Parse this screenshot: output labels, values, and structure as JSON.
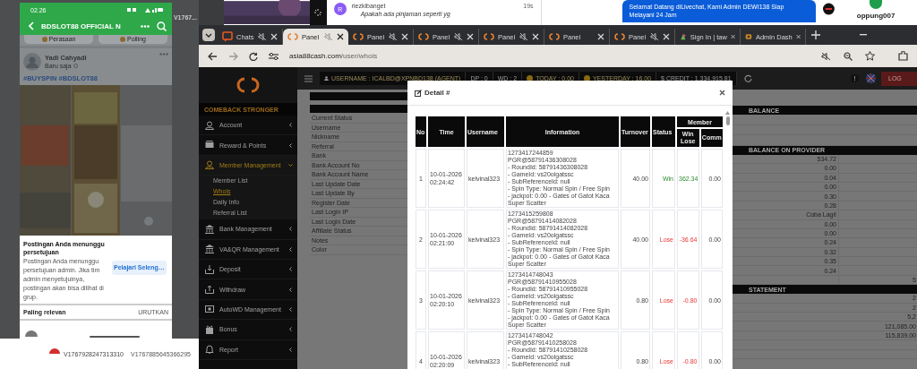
{
  "left_app": {
    "top_label": "V1767...",
    "rows": [
      {
        "label": "V1767928247313310"
      }
    ],
    "preview_label": "V1767885645366295"
  },
  "chat_app": {
    "contact": {
      "initial": "R",
      "name": "riezkibanget",
      "time": "19s",
      "message": "Apakah ada pinjaman seperti yg"
    },
    "bubble": "Selamat Datang diLivechat, Kami Admin DEWI138 Siap Melayani 24 Jam",
    "username": "oppung007"
  },
  "phone": {
    "time": "02.26",
    "title": "BDSLOT88 OFFICIAL N",
    "chips": [
      "Perasaan",
      "Polling"
    ],
    "post": {
      "author": "Yadi Cahyadi",
      "meta": "Baru saja",
      "hashtags": "#BUYSPIN #BDSLOT88"
    },
    "sheet": {
      "title": "Postingan Anda menunggu persetujuan",
      "body": "Postingan Anda menunggu persetujuan admin. Jika tim admin menyetujuinya, postingan akan bisa dilihat di grup.",
      "button": "Pelajari Seleng…"
    },
    "sort": {
      "label": "Paling relevan",
      "action": "URUTKAN"
    }
  },
  "browser": {
    "tabs": [
      {
        "title": "Chats",
        "kind": "chat",
        "selected": false,
        "muted": true
      },
      {
        "title": "Panel",
        "kind": "panel",
        "selected": true,
        "muted": true
      },
      {
        "title": "Panel",
        "kind": "panel",
        "selected": false,
        "muted": true
      },
      {
        "title": "Panel",
        "kind": "panel",
        "selected": false,
        "muted": true
      },
      {
        "title": "Panel",
        "kind": "panel",
        "selected": false,
        "muted": true
      },
      {
        "title": "Panel",
        "kind": "panel",
        "selected": false,
        "muted": false
      },
      {
        "title": "Panel",
        "kind": "panel",
        "selected": false,
        "muted": true
      },
      {
        "title": "Sign In | taw",
        "kind": "signin",
        "selected": false,
        "muted": false
      },
      {
        "title": "Admin Dash",
        "kind": "admin",
        "selected": false,
        "muted": false
      }
    ],
    "url": {
      "domain": "asia88cash.com",
      "path": "/user/whois"
    }
  },
  "header": {
    "stats": [
      {
        "kind": "user",
        "text": "USERNAME : ICALBD@XPNBD138 (AGENT)"
      },
      {
        "kind": "plain",
        "text": "DP : 0"
      },
      {
        "kind": "plain",
        "text": "WD : 2"
      },
      {
        "kind": "coin",
        "text": "TODAY : 0.00"
      },
      {
        "kind": "coin",
        "text": "YESTERDAY : 16.00"
      },
      {
        "kind": "plain",
        "text": "$ CREDIT : 1,334,915.81"
      }
    ],
    "logout": "LOG"
  },
  "sidebar": {
    "slogan": "COMEBACK STRONGER",
    "items": [
      {
        "label": "Account",
        "selected": false,
        "expanded": false
      },
      {
        "label": "Reward & Points",
        "selected": false,
        "expanded": false
      },
      {
        "label": "Member Management",
        "selected": true,
        "expanded": true,
        "children": [
          {
            "label": "Member List",
            "selected": false
          },
          {
            "label": "Whois",
            "selected": true
          },
          {
            "label": "Daily Info",
            "selected": false
          },
          {
            "label": "Referral List",
            "selected": false
          }
        ]
      },
      {
        "label": "Bank Management",
        "selected": false,
        "expanded": false
      },
      {
        "label": "VA&QR Management",
        "selected": false,
        "expanded": false
      },
      {
        "label": "Deposit",
        "selected": false,
        "expanded": false
      },
      {
        "label": "Withdraw",
        "selected": false,
        "expanded": false
      },
      {
        "label": "AutoWD Management",
        "selected": false,
        "expanded": false
      },
      {
        "label": "Bonus",
        "selected": false,
        "expanded": false
      },
      {
        "label": "Report",
        "selected": false,
        "expanded": false
      }
    ]
  },
  "profile_labels": [
    "Current Status",
    "Username",
    "Nickname",
    "Referral",
    "Bank",
    "Bank Account No",
    "Bank Account Name",
    "Last Update Date",
    "Last Update By",
    "Register Date",
    "Last Login IP",
    "Last Login Date",
    "Affiliate Status",
    "Notes",
    "Color"
  ],
  "balance": {
    "title": "BALANCE",
    "provider_title": "BALANCE ON PROVIDER",
    "provider_rows": [
      {
        "value": "534.72"
      },
      {
        "value": "0.00"
      },
      {
        "value": "0.04"
      },
      {
        "value": "0.00"
      },
      {
        "value": "0.30"
      },
      {
        "value": "0.28"
      },
      {
        "value": "Coba Lagi!"
      },
      {
        "value": "0.00"
      },
      {
        "value": "0.00"
      },
      {
        "value": "0.24"
      },
      {
        "value": "0.32"
      },
      {
        "value": "0.35"
      },
      {
        "value": "0.24"
      },
      {
        "column_2": "5"
      }
    ],
    "statement_title": "STATEMENT",
    "statement_rows": [
      {
        "column_2": "2"
      },
      {
        "column_2": "2"
      },
      {
        "column_2": "5,2"
      },
      {
        "column_2": "121,085.00"
      },
      {
        "column_2": "115,839.00"
      },
      {},
      {}
    ]
  },
  "modal": {
    "title": "Detail #",
    "columns": [
      "No",
      "Time",
      "Username",
      "Information",
      "Turnover",
      "Status"
    ],
    "group": "Member",
    "sub_columns": [
      "Win Lose",
      "Comm"
    ],
    "rows": [
      {
        "no": "1",
        "time": "10-01-2026 02:24:42",
        "username": "kelvinal323",
        "info": [
          "1273417244859",
          "PGR@58791436308028",
          "- RoundId: 58791436308028",
          "- GameId: vs20olgatssc",
          "- SubReferenceId: null",
          "- Spin Type: Normal Spin / Free Spin",
          "- jackpot: 0.00 - Gates of Gatot Kaca",
          "Super Scatter"
        ],
        "turnover": "40.00",
        "status": "Win",
        "kind": "win",
        "win_lose": "362.34",
        "comm": "0.00"
      },
      {
        "no": "2",
        "time": "10-01-2026 02:21:00",
        "username": "kelvinal323",
        "info": [
          "1273415259808",
          "PGR@58791414082028",
          "- RoundId: 58791414082028",
          "- GameId: vs20olgatssc",
          "- SubReferenceId: null",
          "- Spin Type: Normal Spin / Free Spin",
          "- jackpot: 0.00 - Gates of Gatot Kaca",
          "Super Scatter"
        ],
        "turnover": "40.00",
        "status": "Lose",
        "kind": "lose",
        "win_lose": "-36.64",
        "comm": "0.00"
      },
      {
        "no": "3",
        "time": "10-01-2026 02:20:10",
        "username": "kelvinal323",
        "info": [
          "1273414748043",
          "PGR@58791410955028",
          "- RoundId: 58791410955028",
          "- GameId: vs20olgatssc",
          "- SubReferenceId: null",
          "- Spin Type: Normal Spin / Free Spin",
          "- jackpot: 0.00 - Gates of Gatot Kaca",
          "Super Scatter"
        ],
        "turnover": "0.80",
        "status": "Lose",
        "kind": "lose",
        "win_lose": "-0.80",
        "comm": "0.00"
      },
      {
        "no": "4",
        "time": "10-01-2026 02:20:09",
        "username": "kelvinal323",
        "info": [
          "1273414748042",
          "PGR@58791410258028",
          "- RoundId: 58791410258028",
          "- GameId: vs20olgatssc",
          "- SubReferenceId: null"
        ],
        "turnover": "0.80",
        "status": "Lose",
        "kind": "lose",
        "win_lose": "-0.80",
        "comm": "0.00"
      }
    ]
  }
}
